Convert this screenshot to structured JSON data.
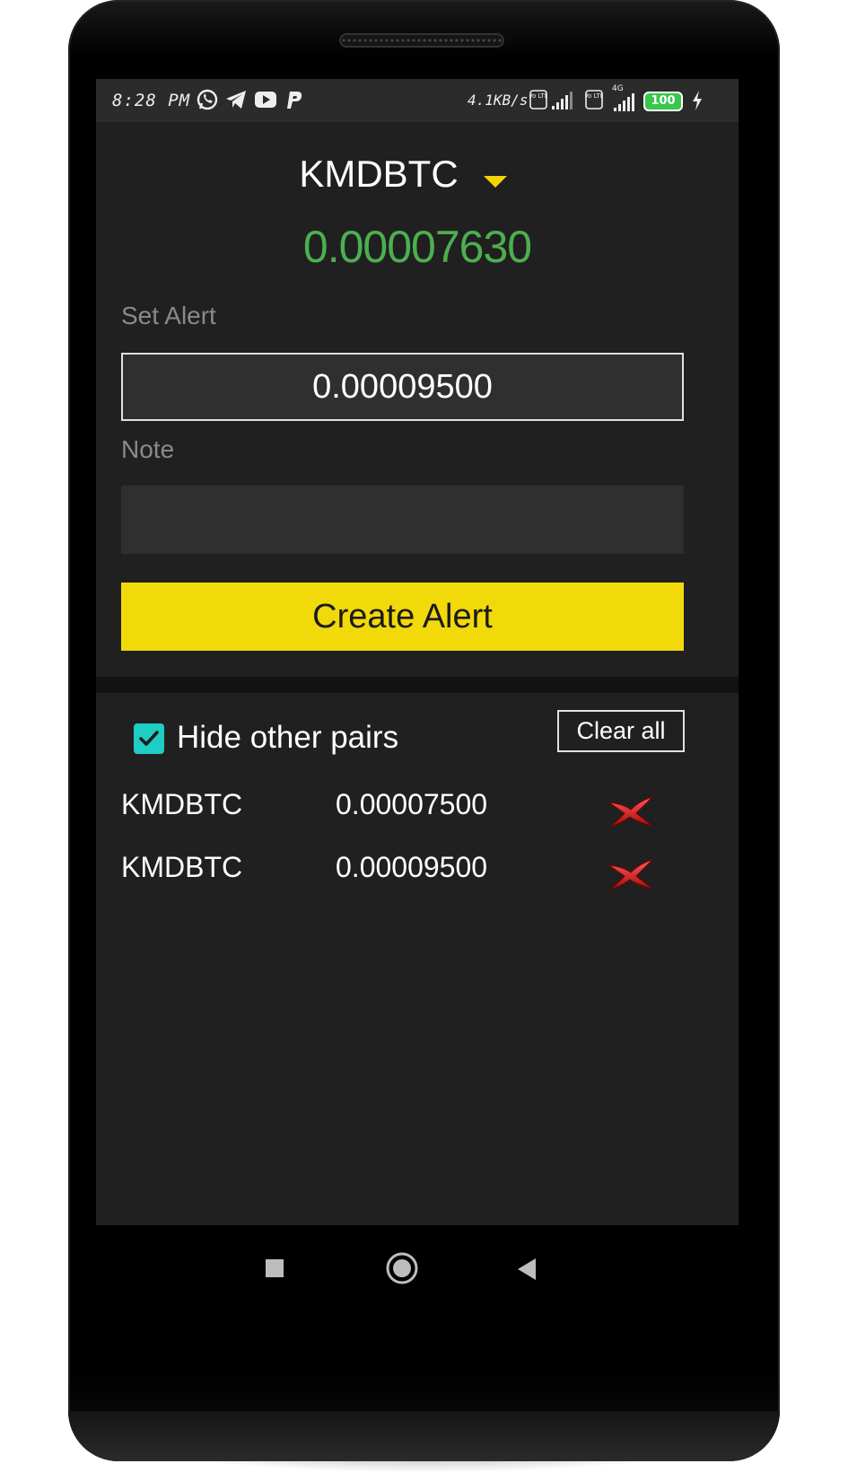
{
  "status_bar": {
    "time": "8:28 PM",
    "net_speed": "4.1KB/s",
    "volte_1": "Vo LTE",
    "volte_2": "Vo LTE",
    "network_type": "4G",
    "battery": "100",
    "icons": [
      "whatsapp-icon",
      "telegram-icon",
      "youtube-icon",
      "paypal-icon",
      "signal-icon",
      "charging-icon"
    ]
  },
  "selector": {
    "pair": "KMDBTC"
  },
  "current_price": "0.00007630",
  "form": {
    "alert_label": "Set Alert",
    "alert_value": "0.00009500",
    "note_label": "Note",
    "note_value": "",
    "create_button": "Create Alert"
  },
  "alerts_panel": {
    "hide_other_pairs_label": "Hide other pairs",
    "hide_other_pairs_checked": true,
    "clear_all_button": "Clear all",
    "alerts": [
      {
        "pair": "KMDBTC",
        "value": "0.00007500"
      },
      {
        "pair": "KMDBTC",
        "value": "0.00009500"
      }
    ]
  },
  "colors": {
    "accent_yellow": "#f2d90a",
    "price_green": "#4caf50",
    "checkbox_teal": "#1ecdc3",
    "delete_red": "#d81e1e",
    "panel_bg": "#202020"
  },
  "nav_bar": {
    "items": [
      "recents-square-icon",
      "home-circle-icon",
      "back-triangle-icon"
    ]
  }
}
